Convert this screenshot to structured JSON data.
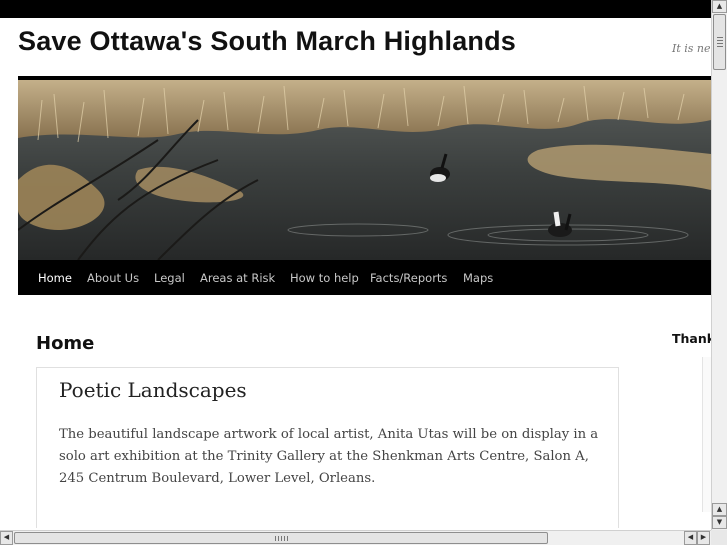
{
  "site": {
    "title": "Save Ottawa's South March Highlands",
    "tagline": "It is never"
  },
  "nav": {
    "items": [
      {
        "label": "Home",
        "active": true
      },
      {
        "label": "About Us"
      },
      {
        "label": "Legal"
      },
      {
        "label": "Areas at Risk"
      },
      {
        "label": "How to help"
      },
      {
        "label": "Facts/Reports"
      },
      {
        "label": "Maps"
      }
    ]
  },
  "main": {
    "heading": "Home",
    "post": {
      "title": "Poetic Landscapes",
      "body": "The beautiful landscape artwork of local artist, Anita Utas will be on display in a solo art exhibition at the Trinity Gallery at the Shenkman Arts Centre, Salon A, 245 Centrum Boulevard, Lower Level, Orleans."
    }
  },
  "sidebar": {
    "heading": "Thank"
  },
  "scrollbars": {
    "up_arrow": "▲",
    "down_arrow": "▼",
    "left_arrow": "◀",
    "right_arrow": "▶"
  }
}
